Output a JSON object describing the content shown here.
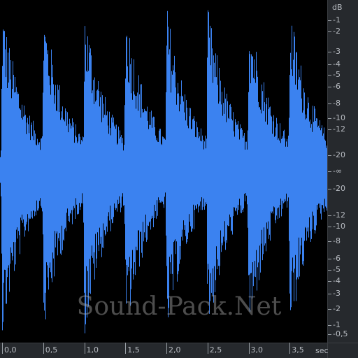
{
  "waveform": {
    "color": "#3b82f0",
    "background": "#000000",
    "duration_sec": 3.9,
    "hits_sec": [
      0.0,
      0.5,
      1.0,
      1.5,
      2.0,
      2.5,
      3.0,
      3.5
    ]
  },
  "db_ruler": {
    "unit": "dB",
    "upper_labels": [
      "-1",
      "-2",
      "-3",
      "-4",
      "-5",
      "-6",
      "-8",
      "-10",
      "-12",
      "-20"
    ],
    "center_label": "-∞",
    "lower_labels": [
      "-20",
      "-12",
      "-10",
      "-8",
      "-6",
      "-5",
      "-4",
      "-3",
      "-2",
      "-1",
      "-0,5"
    ]
  },
  "time_ruler": {
    "unit": "sec",
    "labels": [
      "0,0",
      "0,5",
      "1,0",
      "1,5",
      "2,0",
      "2,5",
      "3,0",
      "3,5"
    ]
  },
  "watermark": "Sound-Pack.Net",
  "colors": {
    "ruler_bg": "#26292d",
    "ruler_text": "#b8bcc2"
  }
}
